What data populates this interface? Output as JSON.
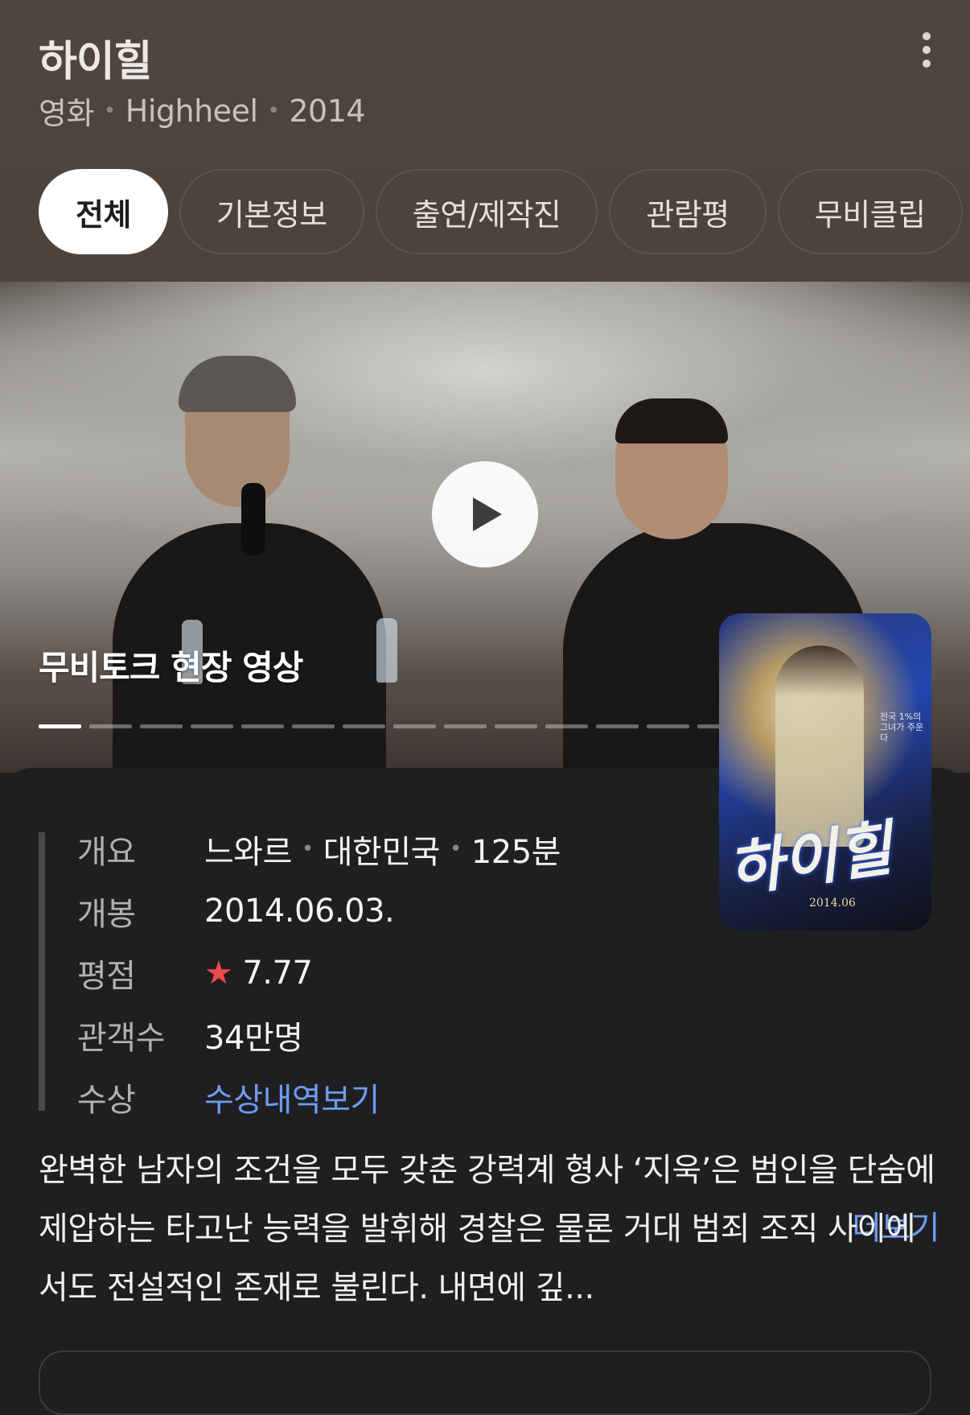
{
  "header": {
    "title": "하이힐",
    "subtitle": {
      "category": "영화",
      "original_title": "Highheel",
      "year": "2014"
    },
    "more_icon": "more-vertical-icon"
  },
  "tabs": [
    {
      "label": "전체",
      "active": true
    },
    {
      "label": "기본정보",
      "active": false
    },
    {
      "label": "출연/제작진",
      "active": false
    },
    {
      "label": "관람평",
      "active": false
    },
    {
      "label": "무비클립",
      "active": false
    }
  ],
  "video": {
    "title": "무비토크 현장 영상",
    "play_icon": "play-icon",
    "segments_total": 14,
    "segment_active": 1
  },
  "info": {
    "rows": [
      {
        "label": "개요",
        "values": [
          "느와르",
          "대한민국",
          "125분"
        ]
      },
      {
        "label": "개봉",
        "value": "2014.06.03."
      },
      {
        "label": "평점",
        "value": "7.77",
        "icon": "star-icon"
      },
      {
        "label": "관객수",
        "value": "34만명"
      },
      {
        "label": "수상",
        "value": "수상내역보기"
      }
    ]
  },
  "poster": {
    "title_art": "하이힐",
    "date": "2014.06"
  },
  "summary": {
    "text": "완벽한 남자의 조건을 모두 갖춘 강력계 형사 ‘지욱’은 범인을 단숨에 제압하는 타고난 능력을 발휘해 경찰은 물론 거대 범죄 조직 사이에서도 전설적인 존재로 불린다. 내면에 깊...",
    "more_label": "더보기"
  },
  "colors": {
    "header_bg": "#4d433b",
    "card_bg": "#1f1f21",
    "link": "#6f9cf3",
    "star": "#ef4b4b"
  }
}
